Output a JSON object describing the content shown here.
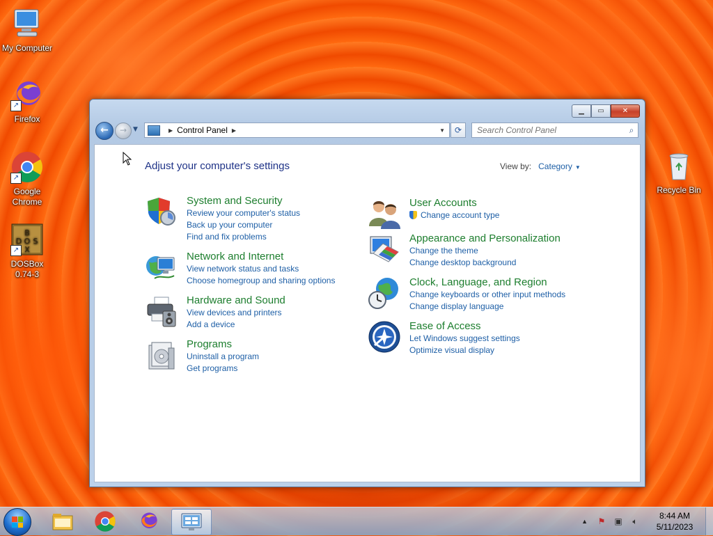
{
  "desktop": {
    "icons": [
      {
        "label": "My Computer",
        "icon": "computer-icon"
      },
      {
        "label": "Firefox",
        "icon": "firefox-icon"
      },
      {
        "label": "Google Chrome",
        "icon": "chrome-icon"
      },
      {
        "label": "DOSBox 0.74-3",
        "icon": "dosbox-icon"
      },
      {
        "label": "Recycle Bin",
        "icon": "recycle-bin-icon"
      }
    ]
  },
  "window": {
    "breadcrumb": {
      "root": "Control Panel"
    },
    "search_placeholder": "Search Control Panel",
    "page_title": "Adjust your computer's settings",
    "view_by": {
      "label": "View by:",
      "value": "Category"
    },
    "categories_left": [
      {
        "title": "System and Security",
        "icon": "shield-icon",
        "links": [
          "Review your computer's status",
          "Back up your computer",
          "Find and fix problems"
        ]
      },
      {
        "title": "Network and Internet",
        "icon": "network-globe-icon",
        "links": [
          "View network status and tasks",
          "Choose homegroup and sharing options"
        ]
      },
      {
        "title": "Hardware and Sound",
        "icon": "printer-icon",
        "links": [
          "View devices and printers",
          "Add a device"
        ]
      },
      {
        "title": "Programs",
        "icon": "programs-box-icon",
        "links": [
          "Uninstall a program",
          "Get programs"
        ]
      }
    ],
    "categories_right": [
      {
        "title": "User Accounts",
        "icon": "users-icon",
        "links": [
          "Change account type"
        ]
      },
      {
        "title": "Appearance and Personalization",
        "icon": "monitor-palette-icon",
        "links": [
          "Change the theme",
          "Change desktop background"
        ]
      },
      {
        "title": "Clock, Language, and Region",
        "icon": "clock-globe-icon",
        "links": [
          "Change keyboards or other input methods",
          "Change display language"
        ]
      },
      {
        "title": "Ease of Access",
        "icon": "ease-of-access-icon",
        "links": [
          "Let Windows suggest settings",
          "Optimize visual display"
        ]
      }
    ]
  },
  "taskbar": {
    "pinned": [
      "file-explorer-icon",
      "chrome-icon",
      "firefox-icon",
      "control-panel-icon"
    ],
    "clock": {
      "time": "8:44 AM",
      "date": "5/11/2023"
    }
  },
  "colors": {
    "title_green": "#1d7e2e",
    "link_blue": "#1e5fa6",
    "heading_blue": "#1e3287"
  }
}
